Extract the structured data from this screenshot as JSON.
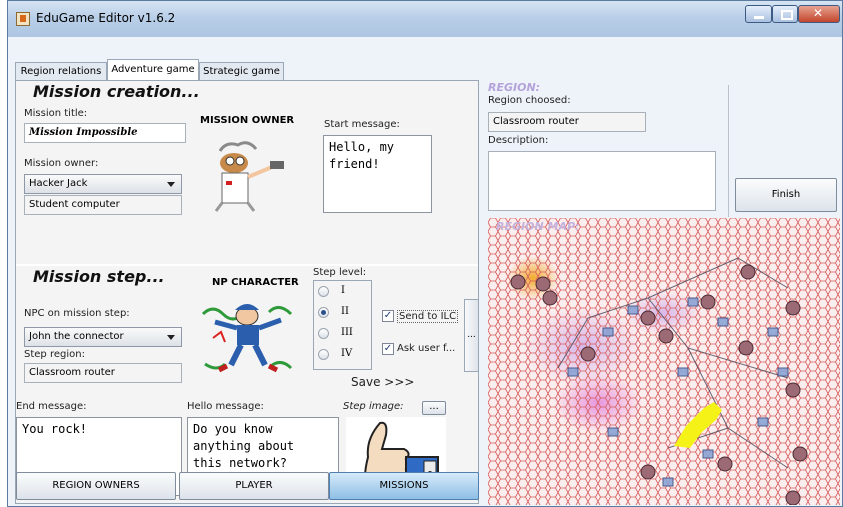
{
  "window": {
    "title": "EduGame Editor v1.6.2",
    "icons": [
      "app-icon",
      "minimize-icon",
      "maximize-icon",
      "close-icon"
    ]
  },
  "tabs": [
    {
      "label": "Region relations",
      "active": false
    },
    {
      "label": "Adventure game",
      "active": true
    },
    {
      "label": "Strategic game",
      "active": false
    }
  ],
  "mission_creation": {
    "heading": "Mission creation...",
    "title_label": "Mission title:",
    "title_value": "Mission Impossible",
    "owner_heading": "MISSION OWNER",
    "owner_label": "Mission owner:",
    "owner_value": "Hacker Jack",
    "owner_location": "Student computer",
    "start_label": "Start message:",
    "start_value": "Hello, my\nfriend!"
  },
  "mission_step": {
    "heading": "Mission step...",
    "npc_heading": "NP CHARACTER",
    "npc_label": "NPC on mission step:",
    "npc_value": "John the connector",
    "region_label": "Step region:",
    "region_value": "Classroom router",
    "level_label": "Step level:",
    "levels": [
      "I",
      "II",
      "III",
      "IV"
    ],
    "selected_level": "II",
    "send_to_ilc": "Send to ILC",
    "send_to_ilc_checked": true,
    "ask_user": "Ask user f...",
    "ask_user_checked": true,
    "save_label": "Save >>>",
    "more_label": "..."
  },
  "messages": {
    "end_label": "End message:",
    "end_value": "You rock!",
    "hello_label": "Hello message:",
    "hello_value": "Do you know\nanything about\nthis network?",
    "step_image_label": "Step image:",
    "step_image_button": "..."
  },
  "bottom_buttons": {
    "region_owners": "REGION OWNERS",
    "player": "PLAYER",
    "missions": "MISSIONS"
  },
  "region": {
    "heading": "REGION:",
    "chosen_label": "Region choosed:",
    "chosen_value": "Classroom router",
    "description_label": "Description:",
    "description_value": "",
    "finish_label": "Finish"
  },
  "map": {
    "heading": "REGION MAP:"
  },
  "colors": {
    "accent_blue": "#8ebfe6",
    "region_heading": "#b4a3da",
    "map_grid": "#d55c5c",
    "highlight_yellow": "#f5f218"
  }
}
